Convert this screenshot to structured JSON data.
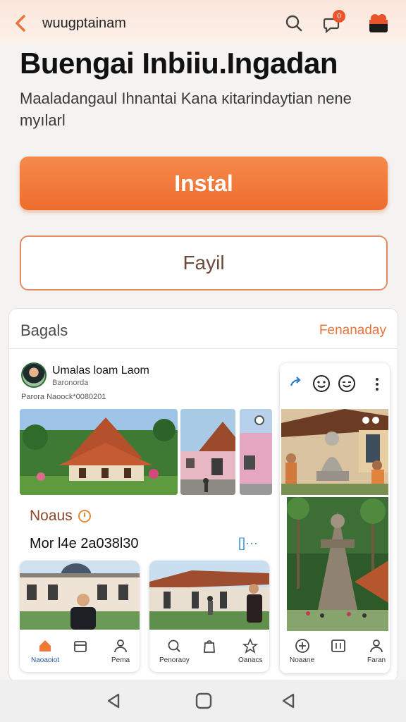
{
  "header": {
    "url": "wuugptainam",
    "notification_count": "0"
  },
  "page": {
    "title": "Buengai Inbiiu.Ingadan",
    "description": "Maaladangaul Ihnantai Kana ĸitarindaytian nene myılarl"
  },
  "actions": {
    "install_label": "Instal",
    "share_label": "Fayil"
  },
  "panel": {
    "heading": "Bagals",
    "link": "Fenanaday"
  },
  "post": {
    "author": "Umalas loam Laom",
    "meta_line1": "Baronorda",
    "meta_line2": "Parora  Naoock*0080201"
  },
  "place": {
    "title": "Noaus",
    "date": "Mor l4e 2a038l30",
    "more_label": "[]···"
  },
  "bottom_nav": {
    "card1": [
      {
        "label": "Naoaoiot",
        "icon": "home-icon",
        "active": true
      },
      {
        "label": "",
        "icon": "store-icon",
        "active": false
      },
      {
        "label": "Pema",
        "icon": "person-icon",
        "active": false
      }
    ],
    "card2": [
      {
        "label": "Penoraoy",
        "icon": "search-icon",
        "active": false
      },
      {
        "label": "",
        "icon": "bag-icon",
        "active": false
      },
      {
        "label": "Oanacs",
        "icon": "bookmark-icon",
        "active": false
      }
    ],
    "card3": [
      {
        "label": "Noaane",
        "icon": "plus-circle-icon",
        "active": false
      },
      {
        "label": "",
        "icon": "grid-icon",
        "active": false
      },
      {
        "label": "Faran",
        "icon": "person-icon",
        "active": false
      }
    ]
  },
  "colors": {
    "accent": "#ee6d2d",
    "link": "#e8743b",
    "blue": "#3d8fd6"
  }
}
